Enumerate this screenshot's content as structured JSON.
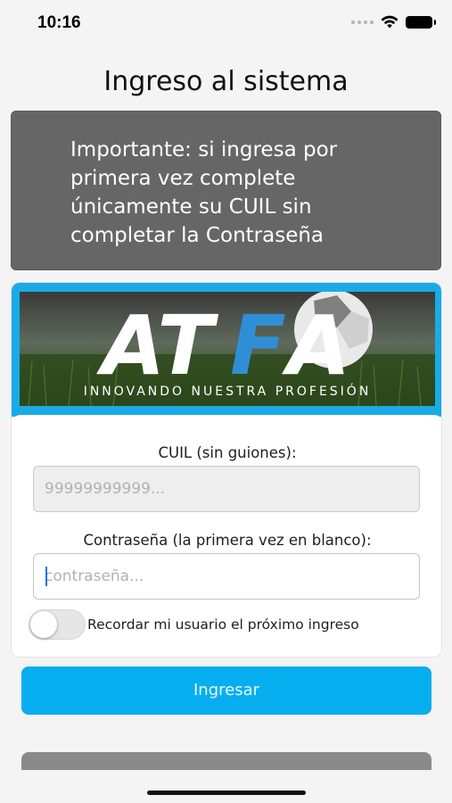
{
  "status_bar": {
    "time": "10:16"
  },
  "page": {
    "title": "Ingreso al sistema"
  },
  "notice": {
    "text": "Importante: si ingresa por primera vez complete únicamente su CUIL sin completar la Contraseña"
  },
  "banner": {
    "logo_text": "ATFA",
    "tagline": "INNOVANDO NUESTRA PROFESIÓN",
    "frame_color": "#1aabe6"
  },
  "form": {
    "cuil_label": "CUIL (sin guiones):",
    "cuil_placeholder": "99999999999...",
    "cuil_value": "",
    "password_label": "Contraseña (la primera vez en blanco):",
    "password_placeholder": "contraseña...",
    "password_value": "",
    "remember_label": "Recordar mi usuario el próximo ingreso",
    "remember_on": false
  },
  "actions": {
    "login_label": "Ingresar",
    "secondary_label": "",
    "primary_color": "#06aeef"
  }
}
